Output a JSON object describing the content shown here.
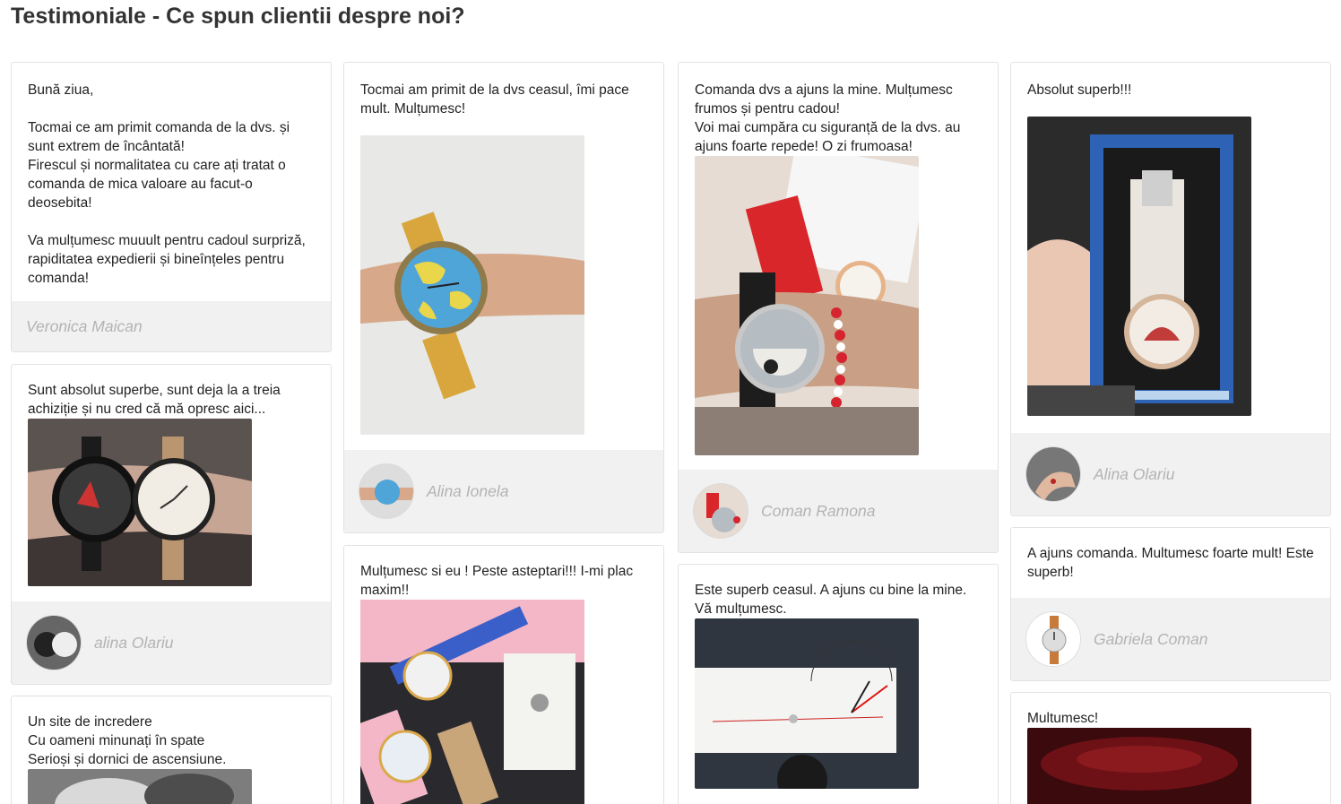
{
  "page": {
    "title": "Testimoniale - Ce spun clientii despre noi?"
  },
  "testimonials": [
    {
      "text": "   Bună ziua,\n\nTocmai ce am primit comanda de la dvs. și sunt extrem de încântată!\nFirescul și normalitatea cu care ați tratat o comanda de mica valoare au facut-o deosebita!\n\nVa mulțumesc muuult pentru cadoul surpriză,  rapiditatea expedierii și bineînțeles pentru comanda!",
      "author": "Veronica Maican"
    },
    {
      "text": "Sunt absolut superbe, sunt deja la a treia achiziție și nu cred că mă opresc aici...",
      "author": "alina Olariu"
    },
    {
      "text": "Un site de incredere\nCu oameni minunați în spate\nSerioși și dornici de ascensiune.",
      "author": ""
    },
    {
      "text": "Tocmai am primit de la dvs ceasul, îmi pace mult. Mulțumesc!",
      "author": "Alina Ionela"
    },
    {
      "text": "Mulțumesc si eu ! Peste asteptari!!! I-mi plac maxim!!",
      "author": ""
    },
    {
      "text": "Comanda dvs a ajuns la mine. Mulțumesc frumos și pentru cadou!\nVoi mai cumpăra cu siguranță de la dvs. au ajuns foarte repede! O zi frumoasa!",
      "author": "Coman Ramona"
    },
    {
      "text": "Este superb ceasul. A ajuns cu bine la mine.\nVă mulțumesc.",
      "author": ""
    },
    {
      "text": "Absolut superb!!!",
      "author": "Alina Olariu"
    },
    {
      "text": "A ajuns comanda. Multumesc foarte mult! Este superb!",
      "author": "Gabriela Coman"
    },
    {
      "text": "Multumesc!",
      "author": ""
    }
  ]
}
